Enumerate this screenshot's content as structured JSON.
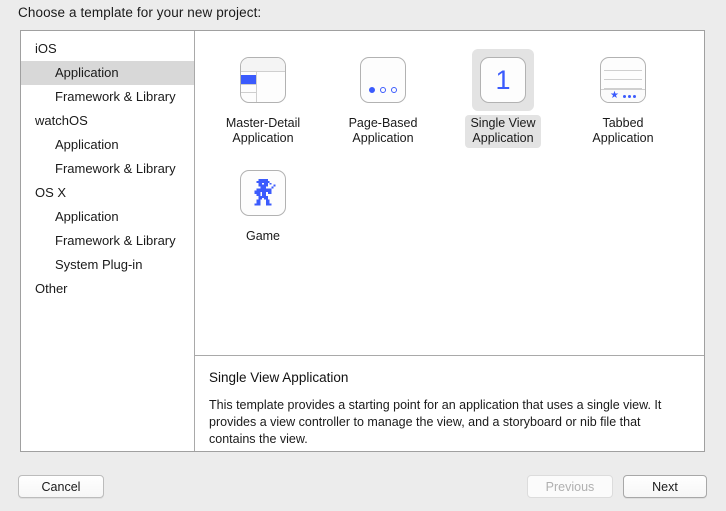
{
  "dialog": {
    "title": "Choose a template for your new project:"
  },
  "sidebar": {
    "items": [
      {
        "label": "iOS",
        "level": "group",
        "selected": false
      },
      {
        "label": "Application",
        "level": "child",
        "selected": true
      },
      {
        "label": "Framework & Library",
        "level": "child",
        "selected": false
      },
      {
        "label": "watchOS",
        "level": "group",
        "selected": false
      },
      {
        "label": "Application",
        "level": "child",
        "selected": false
      },
      {
        "label": "Framework & Library",
        "level": "child",
        "selected": false
      },
      {
        "label": "OS X",
        "level": "group",
        "selected": false
      },
      {
        "label": "Application",
        "level": "child",
        "selected": false
      },
      {
        "label": "Framework & Library",
        "level": "child",
        "selected": false
      },
      {
        "label": "System Plug-in",
        "level": "child",
        "selected": false
      },
      {
        "label": "Other",
        "level": "group",
        "selected": false
      }
    ]
  },
  "templates": [
    {
      "label": "Master-Detail\nApplication",
      "icon": "master-detail-icon",
      "selected": false
    },
    {
      "label": "Page-Based\nApplication",
      "icon": "page-based-icon",
      "selected": false
    },
    {
      "label": "Single View\nApplication",
      "icon": "single-view-icon",
      "selected": true,
      "badge": "1"
    },
    {
      "label": "Tabbed\nApplication",
      "icon": "tabbed-icon",
      "selected": false
    },
    {
      "label": "Game",
      "icon": "game-icon",
      "selected": false
    }
  ],
  "description": {
    "title": "Single View Application",
    "body": "This template provides a starting point for an application that uses a single view. It provides a view controller to manage the view, and a storyboard or nib file that contains the view."
  },
  "footer": {
    "cancel_label": "Cancel",
    "previous_label": "Previous",
    "next_label": "Next"
  },
  "colors": {
    "accent_blue": "#3b5bfd",
    "selection_gray": "#d8d8d8",
    "window_background": "#ececec"
  }
}
